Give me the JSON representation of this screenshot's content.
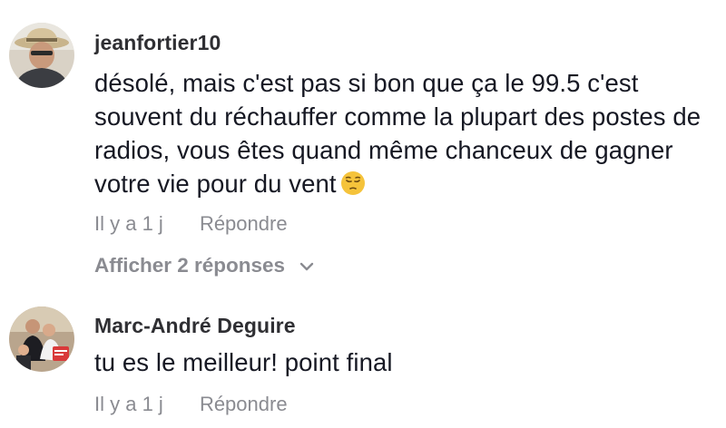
{
  "comments": [
    {
      "username": "jeanfortier10",
      "text": "désolé, mais c'est pas si bon que ça le 99.5 c'est souvent du réchauffer comme la plupart des postes de radios, vous êtes quand même chanceux de gagner votre vie pour du vent",
      "emoji": "pensive-face-emoji",
      "time": "Il y a 1 j",
      "reply_label": "Répondre",
      "view_replies_label": "Afficher 2 réponses"
    },
    {
      "username": "Marc-André Deguire",
      "text": "tu es le meilleur! point final",
      "time": "Il y a 1 j",
      "reply_label": "Répondre"
    }
  ],
  "colors": {
    "text": "#161823",
    "username": "#2f2f33",
    "secondary": "#8a8b91",
    "emoji": "#f5c33b"
  }
}
